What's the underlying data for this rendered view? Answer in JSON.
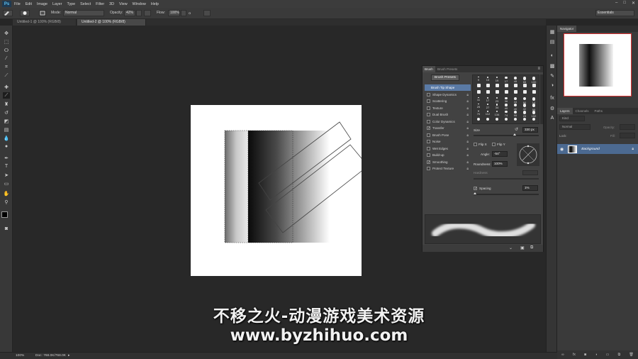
{
  "app": {
    "logo": "Ps"
  },
  "menu": [
    "File",
    "Edit",
    "Image",
    "Layer",
    "Type",
    "Select",
    "Filter",
    "3D",
    "View",
    "Window",
    "Help"
  ],
  "window_controls": [
    "–",
    "□",
    "✕"
  ],
  "options": {
    "mode_label": "Mode:",
    "mode_value": "Normal",
    "opacity_label": "Opacity:",
    "opacity_value": "42%",
    "flow_label": "Flow:",
    "flow_value": "100%",
    "workspace": "Essentials"
  },
  "tabs": [
    "Untitled-1 @ 100% (RGB/8)",
    "Untitled-2 @ 100% (RGB/8)"
  ],
  "status": {
    "zoom": "100%",
    "doc": "Doc: 768.0K/768.0K"
  },
  "navigator": {
    "tab": "Navigator"
  },
  "layers_panel": {
    "tabs": [
      "Layers",
      "Channels",
      "Paths"
    ],
    "kind": "Kind",
    "blend": "Normal",
    "opacity_label": "Opacity:",
    "fill_label": "Fill:",
    "lock_label": "Lock:",
    "layer_name": "Background"
  },
  "brush_panel": {
    "tabs": [
      "Brush",
      "Brush Presets"
    ],
    "presets_button": "Brush Presets",
    "items": [
      {
        "label": "Brush Tip Shape",
        "checked": false,
        "selected": true
      },
      {
        "label": "Shape Dynamics",
        "checked": false
      },
      {
        "label": "Scattering",
        "checked": false
      },
      {
        "label": "Texture",
        "checked": false
      },
      {
        "label": "Dual Brush",
        "checked": false
      },
      {
        "label": "Color Dynamics",
        "checked": false
      },
      {
        "label": "Transfer",
        "checked": true
      },
      {
        "label": "Brush Pose",
        "checked": false
      },
      {
        "label": "Noise",
        "checked": false
      },
      {
        "label": "Wet Edges",
        "checked": false
      },
      {
        "label": "Build-up",
        "checked": false
      },
      {
        "label": "Smoothing",
        "checked": true
      },
      {
        "label": "Protect Texture",
        "checked": false
      }
    ],
    "tip_sizes": [
      "9",
      "13",
      "19",
      "17",
      "45",
      "65",
      "100",
      "200",
      "25",
      "50",
      "25",
      "36",
      "71",
      "39",
      "40",
      "42",
      "55",
      "70",
      "112",
      "134",
      "74",
      "95",
      "95",
      "90",
      "36",
      "30",
      "14",
      "24",
      "27",
      "39",
      "46",
      "59",
      "11",
      "17",
      "23",
      "36",
      "44",
      "60",
      "14",
      "26",
      "33",
      "42",
      "55",
      "70",
      "112",
      "134",
      "74",
      "95",
      "29",
      "192",
      "36",
      "33",
      "63",
      "66",
      "39",
      "63",
      "11",
      "48",
      "32",
      "55",
      "100",
      "75",
      "45",
      "1",
      "5",
      "15",
      "30",
      "2",
      "0",
      "1",
      "5"
    ],
    "tip_grid_rows": [
      [
        "9",
        "13",
        "19",
        "17",
        "45",
        "65",
        "100"
      ],
      [
        "",
        "",
        "",
        "",
        "",
        "",
        ""
      ],
      [
        "",
        "",
        "",
        "",
        "",
        "",
        ""
      ],
      [
        "11",
        "17",
        "23",
        "36",
        "44",
        "60",
        "14"
      ],
      [
        "25",
        "27",
        "34",
        "40",
        "40",
        "42",
        "55"
      ],
      [
        "70",
        "112",
        "134",
        "74",
        "95",
        "29",
        "192"
      ],
      [
        "",
        "",
        "",
        "",
        "",
        "",
        ""
      ]
    ],
    "size_label": "Size",
    "size_value": "330 px",
    "flip_x": "Flip X",
    "flip_y": "Flip Y",
    "angle_label": "Angle:",
    "angle_value": "-54°",
    "roundness_label": "Roundness:",
    "roundness_value": "100%",
    "hardness_label": "Hardness",
    "spacing_label": "Spacing",
    "spacing_value": "1%"
  },
  "watermark": {
    "line1": "不移之火-动漫游戏美术资源",
    "line2": "www.byzhihuo.com"
  }
}
